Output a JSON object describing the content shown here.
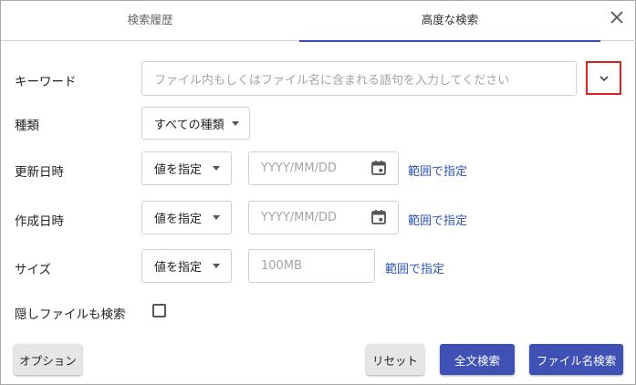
{
  "tabs": {
    "history": "検索履歴",
    "advanced": "高度な検索"
  },
  "keyword": {
    "label": "キーワード",
    "placeholder": "ファイル内もしくはファイル名に含まれる語句を入力してください"
  },
  "type": {
    "label": "種類",
    "selected": "すべての種類"
  },
  "modified": {
    "label": "更新日時",
    "selected": "値を指定",
    "date_placeholder": "YYYY/MM/DD",
    "range_link": "範囲で指定"
  },
  "created": {
    "label": "作成日時",
    "selected": "値を指定",
    "date_placeholder": "YYYY/MM/DD",
    "range_link": "範囲で指定"
  },
  "size": {
    "label": "サイズ",
    "selected": "値を指定",
    "placeholder": "100MB",
    "range_link": "範囲で指定"
  },
  "hidden_files": {
    "label": "隠しファイルも検索",
    "checked": false
  },
  "footer": {
    "options": "オプション",
    "reset": "リセット",
    "fulltext_search": "全文検索",
    "filename_search": "ファイル名検索"
  },
  "colors": {
    "accent": "#3f51b5",
    "link": "#2f55b6",
    "highlight": "#e02020"
  },
  "icons": {
    "close": "close-icon",
    "expand": "chevron-down-icon",
    "calendar": "calendar-icon",
    "dropdown": "caret-down-icon"
  }
}
